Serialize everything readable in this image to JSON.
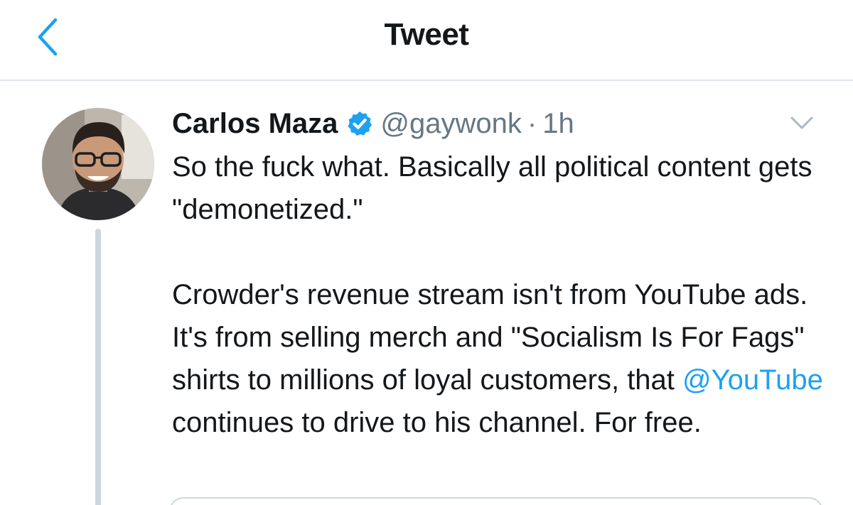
{
  "header": {
    "title": "Tweet"
  },
  "tweet": {
    "display_name": "Carlos Maza",
    "handle": "@gaywonk",
    "separator": "·",
    "timestamp": "1h",
    "paragraph1": "So the fuck what. Basically all political content gets \"demonetized.\"",
    "paragraph2_before_mention": "Crowder's revenue stream isn't from YouTube ads. It's from selling merch and \"Socialism Is For Fags\" shirts to millions of loyal customers, that ",
    "mention": "@YouTube",
    "paragraph2_after_mention": " continues to drive to his channel. For free."
  },
  "icons": {
    "back": "chevron-left-icon",
    "verified": "verified-badge-icon",
    "caret": "chevron-down-icon"
  },
  "colors": {
    "accent": "#1da1f2",
    "text_primary": "#14171a",
    "text_secondary": "#657786",
    "divider": "#e1e8ed",
    "thread_line": "#ccd6dd"
  }
}
